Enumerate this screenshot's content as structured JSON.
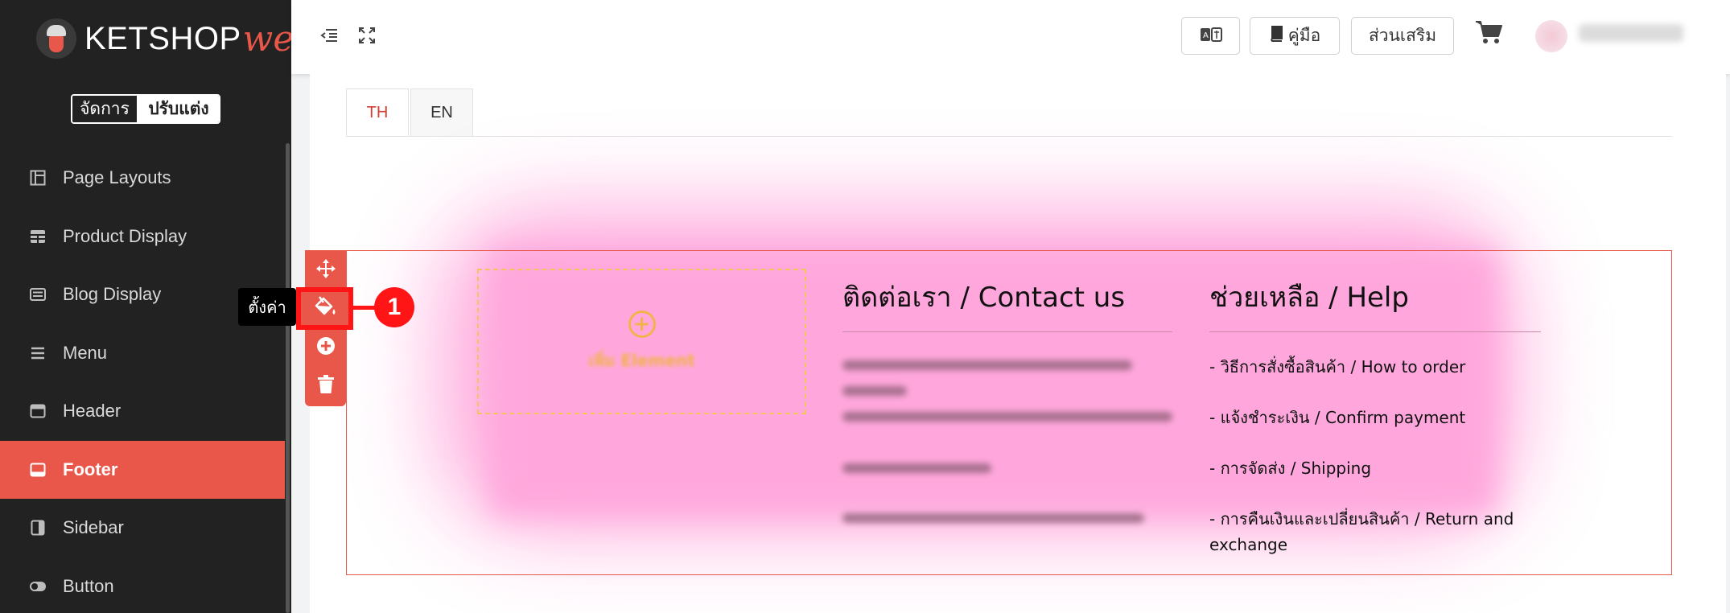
{
  "brand": {
    "name": "KETSHOP",
    "suffix": "web"
  },
  "mode_toggle": {
    "manage": "จัดการ",
    "customize": "ปรับแต่ง"
  },
  "sidebar": {
    "items": [
      {
        "label": "Page Layouts",
        "icon": "layout-icon"
      },
      {
        "label": "Product Display",
        "icon": "grid-icon"
      },
      {
        "label": "Blog Display",
        "icon": "list-icon"
      },
      {
        "label": "Menu",
        "icon": "menu-icon"
      },
      {
        "label": "Header",
        "icon": "window-icon"
      },
      {
        "label": "Footer",
        "icon": "footer-icon",
        "active": true
      },
      {
        "label": "Sidebar",
        "icon": "sidebar-icon"
      },
      {
        "label": "Button",
        "icon": "toggle-icon"
      }
    ]
  },
  "topbar": {
    "manual_label": "คู่มือ",
    "addons_label": "ส่วนเสริม"
  },
  "tabs": [
    {
      "label": "TH",
      "active": true
    },
    {
      "label": "EN",
      "active": false
    }
  ],
  "section": {
    "placeholder_label": "เพิ่ม Element",
    "contact_title": "ติดต่อเรา / Contact us",
    "help_title": "ช่วยเหลือ / Help",
    "help_links": [
      "- วิธีการสั่งซื้อสินค้า / How to order",
      "- แจ้งชำระเงิน / Confirm payment",
      "- การจัดส่ง / Shipping",
      "- การคืนเงินและเปลี่ยนสินค้า / Return and exchange"
    ]
  },
  "toolbar": {
    "settings_tooltip": "ตั้งค่า"
  },
  "annotation": {
    "step_number": "1"
  },
  "colors": {
    "accent": "#e8574a",
    "highlight": "#ff1515",
    "sidebar_bg": "#222222",
    "section_bg": "#ffa7dc"
  }
}
